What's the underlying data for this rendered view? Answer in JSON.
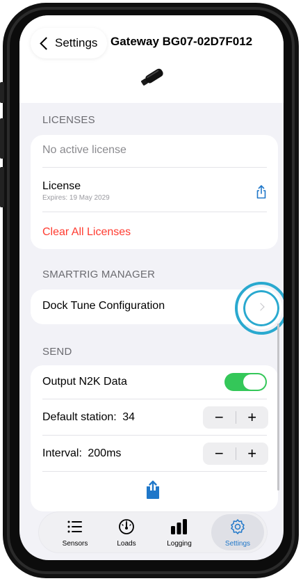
{
  "header": {
    "back_label": "Settings",
    "title": "Gateway BG07-02D7F012",
    "device_icon": "usb-gateway-icon"
  },
  "licenses": {
    "section_label": "LICENSES",
    "no_license_text": "No active license",
    "license_title": "License",
    "license_expiry": "Expires: 19 May 2029",
    "share_icon": "share-icon",
    "clear_label": "Clear All Licenses"
  },
  "smartrig": {
    "section_label": "SMARTRIG MANAGER",
    "dock_tune_label": "Dock Tune Configuration",
    "chevron_icon": "chevron-right-icon"
  },
  "send": {
    "section_label": "SEND",
    "output_label": "Output N2K Data",
    "output_enabled": true,
    "station_label": "Default station:",
    "station_value": "34",
    "interval_label": "Interval:",
    "interval_value": "200ms",
    "minus": "−",
    "plus": "+",
    "upload_icon": "upload-icon"
  },
  "tabs": [
    {
      "label": "Sensors",
      "icon": "list-icon",
      "active": false
    },
    {
      "label": "Loads",
      "icon": "gauge-icon",
      "active": false
    },
    {
      "label": "Logging",
      "icon": "bar-chart-icon",
      "active": false
    },
    {
      "label": "Settings",
      "icon": "gear-icon",
      "active": true
    }
  ],
  "colors": {
    "accent": "#1f77c9",
    "toggle_on": "#34c759",
    "destructive": "#ff3b30",
    "highlight_ring": "#2aa9cf"
  }
}
